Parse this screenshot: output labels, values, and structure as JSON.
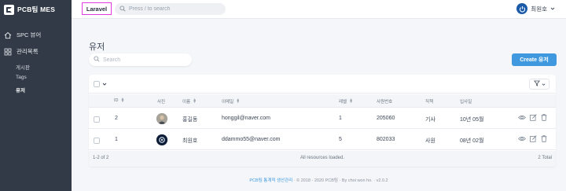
{
  "sidebar": {
    "brand": "PCB팀 MES",
    "spc_viewer": "SPC 뷰어",
    "management": "관리목록",
    "sub_items": [
      "게시판",
      "Tags",
      "유저"
    ]
  },
  "header": {
    "laravel_label": "Laravel",
    "search_placeholder": "Press / to search",
    "user_name": "최원호"
  },
  "main": {
    "title": "유저",
    "search_placeholder": "Search",
    "create_button": "Create 유저"
  },
  "table": {
    "columns": [
      "ID",
      "사진",
      "이름",
      "이메일",
      "레벨",
      "사원번호",
      "직책",
      "입사일"
    ],
    "rows": [
      {
        "id": "2",
        "name": "홍길동",
        "email": "honggil@naver.com",
        "level": "1",
        "employee_no": "205060",
        "position": "기사",
        "join_date": "10년 05월"
      },
      {
        "id": "1",
        "name": "최원호",
        "email": "ddammo55@naver.com",
        "level": "5",
        "employee_no": "802033",
        "position": "사원",
        "join_date": "08년 02월"
      }
    ],
    "footer_range": "1-2 of 2",
    "footer_status": "All resources loaded.",
    "footer_total": "2 Total"
  },
  "footer": {
    "link": "PCB팀 통계적 생산관리",
    "text": "· © 2018 - 2020 PCB팀 · By choi won ho. · v2.0.2"
  },
  "colors": {
    "sidebar": "#313a46",
    "accent": "#4099de",
    "highlight": "#e13be0"
  }
}
